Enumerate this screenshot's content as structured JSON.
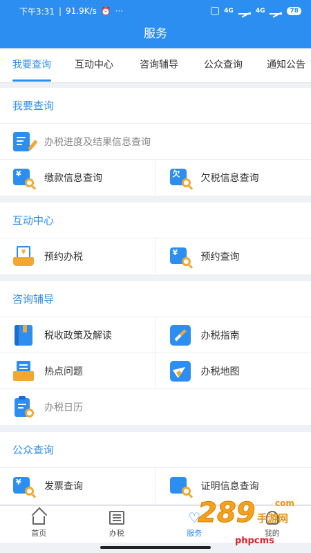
{
  "status_bar": {
    "time": "下午3:31",
    "speed": "91.9K/s",
    "more": "···",
    "signal1": "4G",
    "signal2": "4G",
    "battery": "78"
  },
  "header": {
    "title": "服务"
  },
  "tabs": [
    {
      "label": "我要查询",
      "active": true
    },
    {
      "label": "互动中心"
    },
    {
      "label": "咨询辅导"
    },
    {
      "label": "公众查询"
    },
    {
      "label": "通知公告"
    }
  ],
  "sections": {
    "query": {
      "title": "我要查询",
      "items": [
        "办税进度及结果信息查询",
        "缴款信息查询",
        "欠税信息查询"
      ]
    },
    "interact": {
      "title": "互动中心",
      "items": [
        "预约办税",
        "预约查询"
      ]
    },
    "consult": {
      "title": "咨询辅导",
      "items": [
        "税收政策及解读",
        "办税指南",
        "热点问题",
        "办税地图",
        "办税日历"
      ]
    },
    "public": {
      "title": "公众查询",
      "items": [
        "发票查询",
        "证明信息查询"
      ]
    }
  },
  "icon_glyphs": {
    "pay": "¥",
    "owe": "欠"
  },
  "bottom_nav": [
    {
      "label": "首页",
      "icon": "home-icon"
    },
    {
      "label": "办税",
      "icon": "list-icon"
    },
    {
      "label": "服务",
      "icon": "heart-icon",
      "active": true
    },
    {
      "label": "我的",
      "icon": "user-icon"
    }
  ],
  "watermark": {
    "number": "289",
    "suffix": "com",
    "text": "手游网",
    "site": "phpcms"
  },
  "colors": {
    "primary": "#2b8ef0",
    "accent": "#f0a830",
    "background": "#eef1f5"
  }
}
